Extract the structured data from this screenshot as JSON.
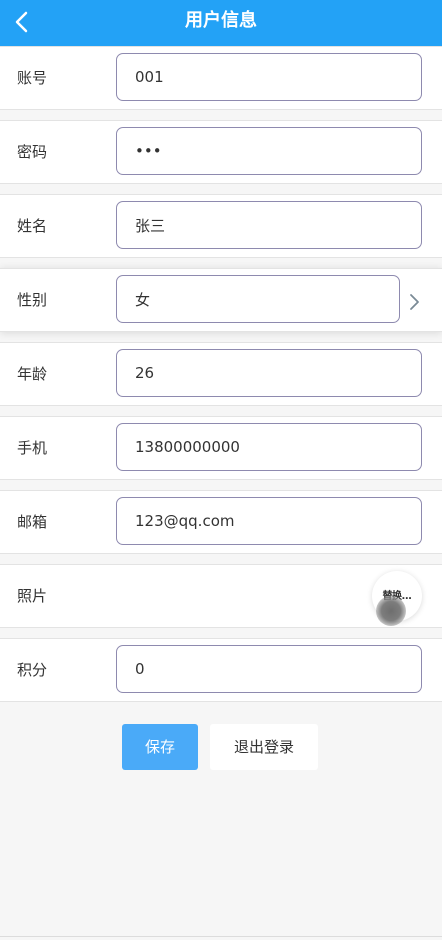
{
  "header": {
    "title": "用户信息"
  },
  "fields": {
    "account": {
      "label": "账号",
      "value": "001"
    },
    "password": {
      "label": "密码",
      "value": "•••"
    },
    "name": {
      "label": "姓名",
      "value": "张三"
    },
    "gender": {
      "label": "性别",
      "value": "女"
    },
    "age": {
      "label": "年龄",
      "value": "26"
    },
    "phone": {
      "label": "手机",
      "value": "13800000000"
    },
    "email": {
      "label": "邮箱",
      "value": "123@qq.com"
    },
    "photo": {
      "label": "照片",
      "upload_label": "替换..."
    },
    "points": {
      "label": "积分",
      "value": "0"
    }
  },
  "actions": {
    "save_label": "保存",
    "logout_label": "退出登录"
  },
  "colors": {
    "header": "#23a2f6",
    "primary_button": "#4aaaf8",
    "input_border": "#8e8aaf"
  }
}
